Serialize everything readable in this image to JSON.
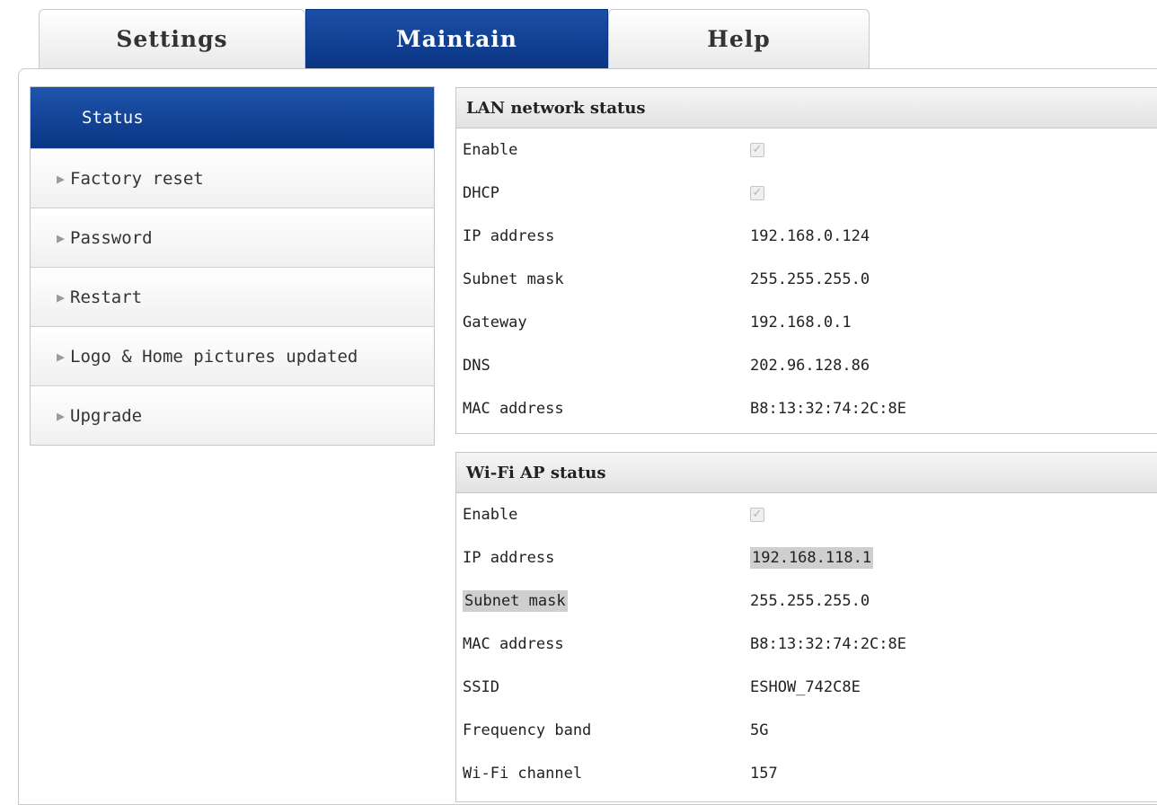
{
  "tabs": {
    "settings": "Settings",
    "maintain": "Maintain",
    "help": "Help"
  },
  "sidebar": {
    "items": [
      {
        "label": "Status",
        "active": true
      },
      {
        "label": "Factory reset"
      },
      {
        "label": "Password"
      },
      {
        "label": "Restart"
      },
      {
        "label": "Logo & Home pictures updated"
      },
      {
        "label": "Upgrade"
      }
    ]
  },
  "lan": {
    "title": "LAN network status",
    "enable_label": "Enable",
    "enable_checked": true,
    "dhcp_label": "DHCP",
    "dhcp_checked": true,
    "ip_label": "IP address",
    "ip_value": "192.168.0.124",
    "subnet_label": "Subnet mask",
    "subnet_value": "255.255.255.0",
    "gateway_label": "Gateway",
    "gateway_value": "192.168.0.1",
    "dns_label": "DNS",
    "dns_value": "202.96.128.86",
    "mac_label": "MAC address",
    "mac_value": "B8:13:32:74:2C:8E"
  },
  "wifi": {
    "title": "Wi-Fi AP status",
    "enable_label": "Enable",
    "enable_checked": true,
    "ip_label": "IP address",
    "ip_value": "192.168.118.1",
    "subnet_label": "Subnet mask",
    "subnet_value": "255.255.255.0",
    "mac_label": "MAC address",
    "mac_value": "B8:13:32:74:2C:8E",
    "ssid_label": "SSID",
    "ssid_value": "ESHOW_742C8E",
    "band_label": "Frequency band",
    "band_value": "5G",
    "channel_label": "Wi-Fi channel",
    "channel_value": "157"
  },
  "colors": {
    "accent": "#0a3584",
    "panel_header": "#e2e2e2",
    "highlight": "#cfcfcf"
  }
}
